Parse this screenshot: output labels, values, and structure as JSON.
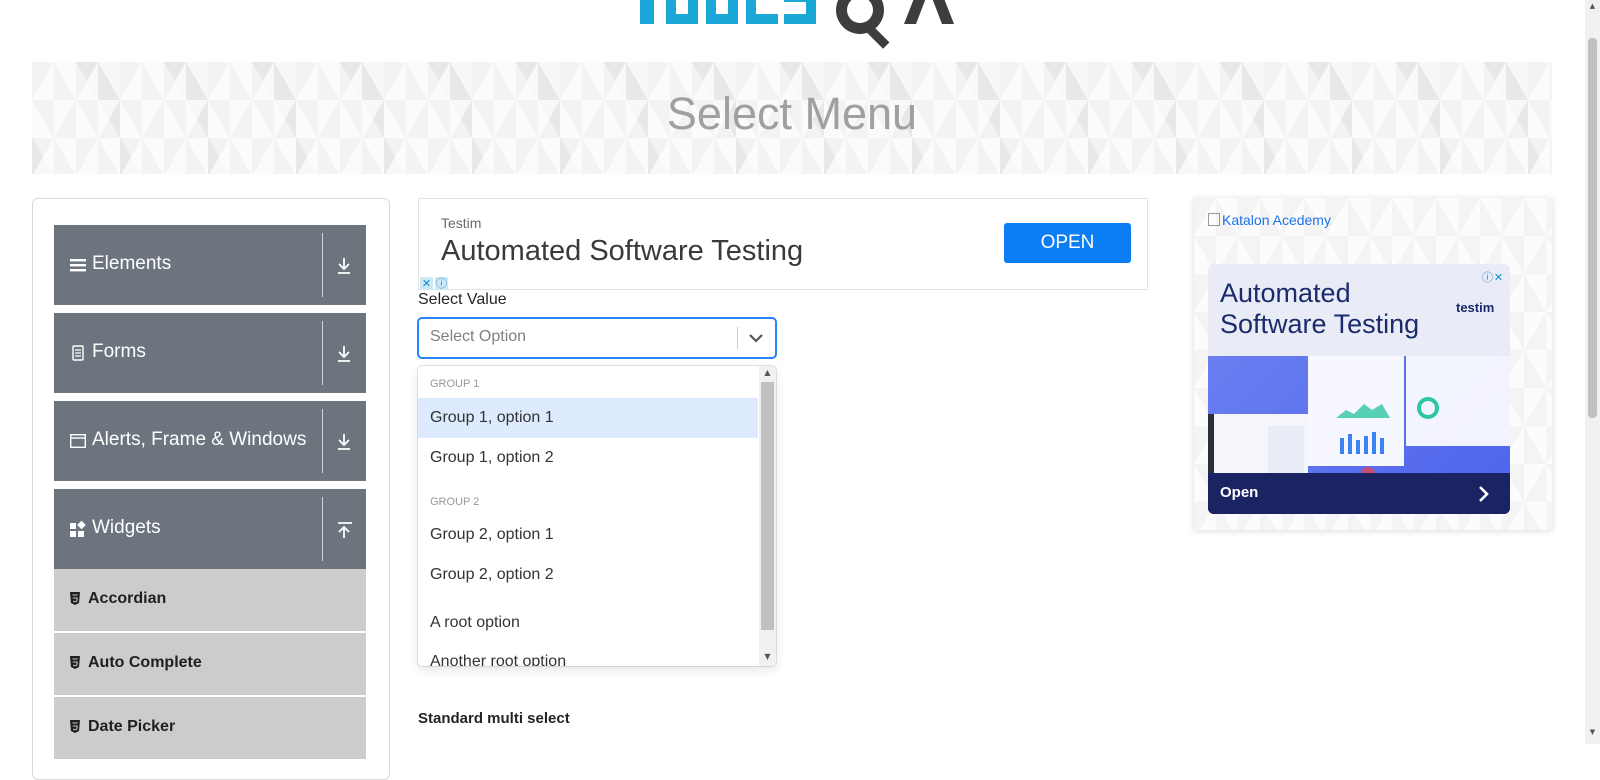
{
  "page": {
    "title": "Select Menu"
  },
  "logo": {
    "alt": "TOOLSQA"
  },
  "sidebar": {
    "groups": [
      {
        "label": "Elements",
        "icon": "hamburger-icon",
        "toggle": "download-arrow-icon"
      },
      {
        "label": "Forms",
        "icon": "document-icon",
        "toggle": "download-arrow-icon"
      },
      {
        "label": "Alerts, Frame & Windows",
        "icon": "window-icon",
        "toggle": "download-arrow-icon"
      },
      {
        "label": "Widgets",
        "icon": "widgets-icon",
        "toggle": "upload-arrow-icon"
      }
    ],
    "widget_items": [
      {
        "label": "Accordian"
      },
      {
        "label": "Auto Complete"
      },
      {
        "label": "Date Picker"
      }
    ]
  },
  "ad_top": {
    "brand": "Testim",
    "headline": "Automated Software Testing",
    "button": "OPEN"
  },
  "select_value": {
    "label": "Select Value",
    "placeholder": "Select Option",
    "menu": {
      "groups": [
        {
          "heading": "GROUP 1",
          "options": [
            "Group 1, option 1",
            "Group 1, option 2"
          ]
        },
        {
          "heading": "GROUP 2",
          "options": [
            "Group 2, option 1",
            "Group 2, option 2"
          ]
        }
      ],
      "root_options": [
        "A root option",
        "Another root option"
      ],
      "focused_option": "Group 1, option 1"
    }
  },
  "standard_multi_select": {
    "label": "Standard multi select"
  },
  "ad_right": {
    "broken_image_alt": "Katalon Acedemy",
    "headline": "Automated Software Testing",
    "brand": "testim",
    "cta": "Open"
  },
  "colors": {
    "sidebar_header_bg": "#6c757d",
    "sidebar_item_bg": "#cccccc",
    "select_focus_border": "#2684ff",
    "option_focused_bg": "#deebff",
    "ad_button_bg": "#0b7df5",
    "logo_blue": "#1ba7d8",
    "logo_dark": "#3d3d3d"
  }
}
